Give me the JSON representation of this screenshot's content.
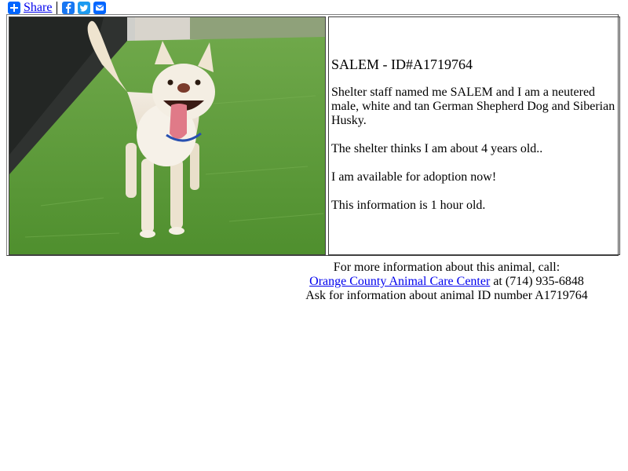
{
  "share": {
    "label": "Share",
    "icons": [
      "share-plus-icon",
      "facebook-icon",
      "twitter-icon",
      "email-icon"
    ]
  },
  "animal": {
    "title": "SALEM - ID#A1719764",
    "description": "Shelter staff named me SALEM and I am a neutered male, white and tan German Shepherd Dog and Siberian Husky.",
    "age": "The shelter thinks I am about 4 years old..",
    "availability": "I am available for adoption now!",
    "freshness": "This information is 1 hour old."
  },
  "contact": {
    "intro": "For more information about this animal, call:",
    "shelter_name": "Orange County Animal Care Center",
    "phone_prefix": " at ",
    "phone": "(714) 935-6848",
    "ask_text": "Ask for information about animal ID number A1719764"
  },
  "colors": {
    "link": "#0000ee",
    "share_blue": "#0166ff",
    "facebook": "#1877f2",
    "twitter": "#1d9bf0",
    "turf_green": "#5f9e3d"
  }
}
